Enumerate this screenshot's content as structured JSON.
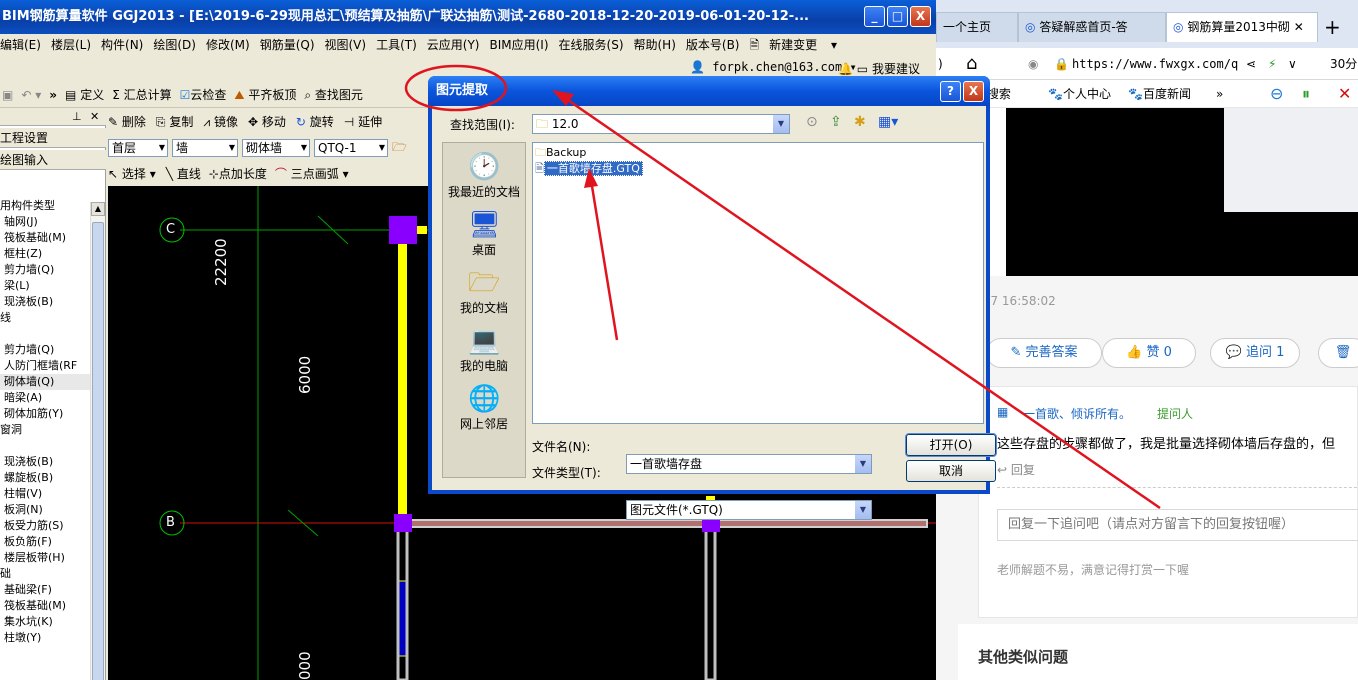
{
  "app": {
    "title": "BIM钢筋算量软件 GGJ2013 - [E:\\2019-6-29现用总汇\\预结算及抽筋\\广联达抽筋\\测试-2680-2018-12-20-2019-06-01-20-12-...",
    "window_buttons": {
      "minimize": "_",
      "maximize": "□",
      "close": "X"
    },
    "menu": [
      "编辑(E)",
      "楼层(L)",
      "构件(N)",
      "绘图(D)",
      "修改(M)",
      "钢筋量(Q)",
      "视图(V)",
      "工具(T)",
      "云应用(Y)",
      "BIM应用(I)",
      "在线服务(S)",
      "帮助(H)",
      "版本号(B)",
      "新建变更"
    ],
    "account": "forpk.chen@163.com",
    "suggest": "我要建议",
    "toolbar1": [
      "定义",
      "汇总计算",
      "云检查",
      "平齐板顶",
      "查找图元"
    ],
    "toolbar2": [
      "删除",
      "复制",
      "镜像",
      "移动",
      "旋转",
      "延伸"
    ],
    "toolbar3": {
      "floor": "首层",
      "category": "墙",
      "type": "砌体墙",
      "name": "QTQ-1"
    },
    "toolbar4": [
      "选择",
      "直线",
      "点加长度",
      "三点画弧"
    ],
    "left_panel": {
      "project_setup": "工程设置",
      "draw_input": "绘图输入",
      "tree": [
        "用构件类型",
        "轴网(J)",
        "筏板基础(M)",
        "框柱(Z)",
        "剪力墙(Q)",
        "梁(L)",
        "现浇板(B)",
        "线",
        "",
        "剪力墙(Q)",
        "人防门框墙(RF",
        "砌体墙(Q)",
        "暗梁(A)",
        "砌体加筋(Y)",
        "窗洞",
        "",
        "现浇板(B)",
        "螺旋板(B)",
        "柱帽(V)",
        "板洞(N)",
        "板受力筋(S)",
        "板负筋(F)",
        "楼层板带(H)",
        "础",
        "基础梁(F)",
        "筏板基础(M)",
        "集水坑(K)",
        "柱墩(Y)"
      ]
    },
    "canvas": {
      "axis_labels": [
        "C",
        "B"
      ],
      "dims": [
        "22200",
        "6000",
        "000"
      ]
    }
  },
  "dialog": {
    "title": "图元提取",
    "help": "?",
    "close": "X",
    "look_in_label": "查找范围(I):",
    "look_in_value": "12.0",
    "places": [
      "我最近的文档",
      "桌面",
      "我的文档",
      "我的电脑",
      "网上邻居"
    ],
    "files": [
      {
        "name": "Backup",
        "kind": "folder",
        "selected": false
      },
      {
        "name": "一首歌墙存盘.GTQ",
        "kind": "file",
        "selected": true
      }
    ],
    "filename_label": "文件名(N):",
    "filename_value": "一首歌墙存盘",
    "filetype_label": "文件类型(T):",
    "filetype_value": "图元文件(*.GTQ)",
    "open_button": "打开(O)",
    "cancel_button": "取消"
  },
  "browser": {
    "tabs": [
      "一个主页",
      "答疑解惑首页-答",
      "钢筋算量2013中砌"
    ],
    "new_tab": "+",
    "url": "https://www.fwxgx.com/q",
    "zoom": "30分",
    "favorites": [
      "360搜索",
      "个人中心",
      "百度新闻"
    ],
    "timestamp": "019-07-07 16:58:02",
    "actions": {
      "complete": "完善答案",
      "like": "赞 0",
      "follow": "追问 1"
    },
    "followup": {
      "user": "一首歌、倾诉所有。",
      "role": "提问人",
      "text": "这些存盘的步骤都做了，我是批量选择砌体墙后存盘的，但",
      "reply": "回复"
    },
    "reply_placeholder": "回复一下追问吧（请点对方留言下的回复按钮喔）",
    "tip": "老师解题不易，满意记得打赏一下喔",
    "similar": "其他类似问题"
  },
  "colors": {
    "title_blue": "#0a55dc",
    "annotation_red": "#e0141e",
    "wall_yellow": "#ffff00",
    "node_purple": "#8a00ff",
    "link_blue": "#1a66c2",
    "role_green": "#3c9b2f"
  }
}
